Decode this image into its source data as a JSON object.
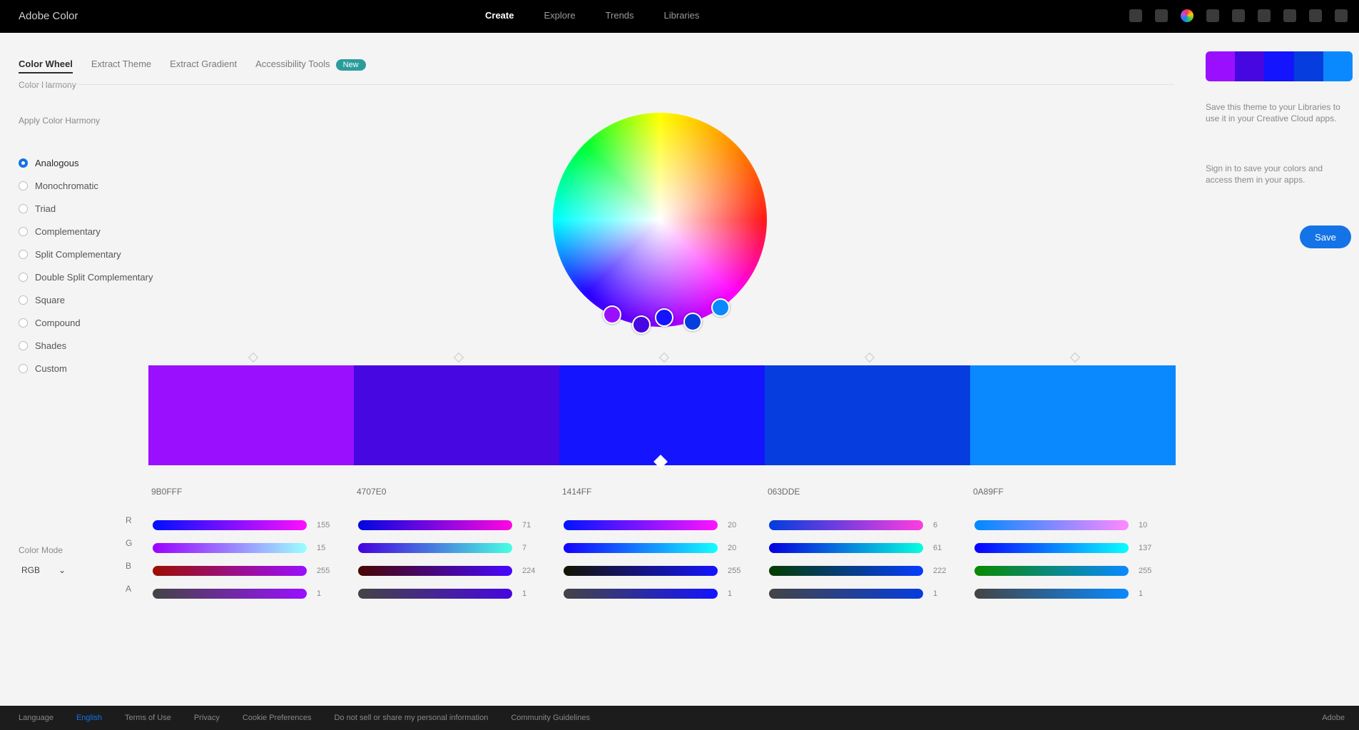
{
  "app": {
    "brand": "Adobe Color"
  },
  "topnav": [
    "Create",
    "Explore",
    "Trends",
    "Libraries"
  ],
  "tabs": {
    "items": [
      "Color Wheel",
      "Extract Theme",
      "Extract Gradient",
      "Accessibility Tools"
    ],
    "badge": "New",
    "sub": "Color Harmony"
  },
  "left": {
    "rule_header": "Apply Color Harmony",
    "rules": [
      "Analogous",
      "Monochromatic",
      "Triad",
      "Complementary",
      "Split Complementary",
      "Double Split Complementary",
      "Square",
      "Compound",
      "Shades",
      "Custom"
    ],
    "color_mode_label": "Color Mode",
    "color_mode_value": "RGB"
  },
  "palette": {
    "colors": [
      "#9B0FFF",
      "#4707E0",
      "#1414FF",
      "#063DDE",
      "#0A89FF"
    ],
    "hex": [
      "9B0FFF",
      "4707E0",
      "1414FF",
      "063DDE",
      "0A89FF"
    ],
    "channels": [
      "R",
      "G",
      "B",
      "A"
    ],
    "values": [
      [
        "155",
        "15",
        "255",
        "1"
      ],
      [
        "71",
        "7",
        "224",
        "1"
      ],
      [
        "20",
        "20",
        "255",
        "1"
      ],
      [
        "6",
        "61",
        "222",
        "1"
      ],
      [
        "10",
        "137",
        "255",
        "1"
      ]
    ]
  },
  "right": {
    "desc1": "Save this theme to your Libraries to use it in your Creative Cloud apps.",
    "desc2": "Sign in to save your colors and access them in your apps.",
    "save_label": "Save"
  },
  "footer": {
    "items": [
      "Language",
      "English",
      "Terms of Use",
      "Privacy",
      "Cookie Preferences",
      "Do not sell or share my personal information",
      "Community Guidelines"
    ],
    "right": "Adobe"
  }
}
